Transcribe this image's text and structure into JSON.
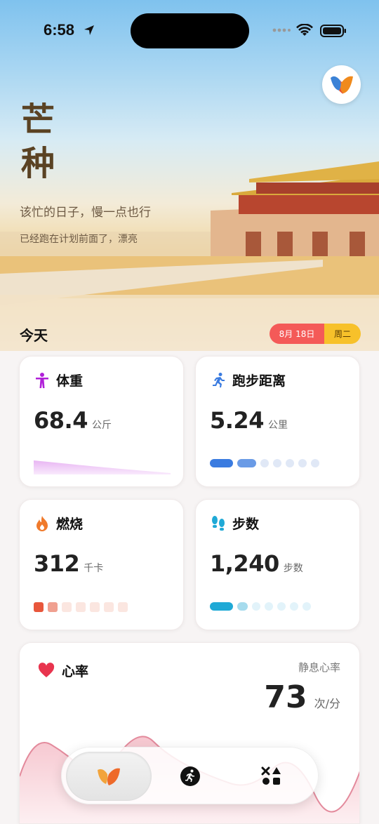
{
  "status": {
    "time": "6:58"
  },
  "hero": {
    "solar_term": "芒种",
    "slogan": "该忙的日子，慢一点也行",
    "subtitle": "已经跑在计划前面了，漂亮"
  },
  "today": {
    "label": "今天",
    "date": "8月 18日",
    "weekday": "周二"
  },
  "cards": {
    "weight": {
      "title": "体重",
      "value": "68.4",
      "unit": "公斤",
      "icon": "person-icon"
    },
    "distance": {
      "title": "跑步距离",
      "value": "5.24",
      "unit": "公里",
      "icon": "runner-icon",
      "progress_filled": 2,
      "progress_total": 7
    },
    "burn": {
      "title": "燃烧",
      "value": "312",
      "unit": "千卡",
      "icon": "flame-icon",
      "progress_filled": 2,
      "progress_total": 7
    },
    "steps": {
      "title": "步数",
      "value": "1,240",
      "unit": "步数",
      "icon": "footprints-icon",
      "progress_filled": 2,
      "progress_total": 7
    },
    "heart": {
      "title": "心率",
      "resting_label": "静息心率",
      "value": "73",
      "unit": "次/分",
      "icon": "heart-icon"
    }
  },
  "tabbar": {
    "items": [
      {
        "name": "home",
        "icon": "brand-logo-icon",
        "active": true
      },
      {
        "name": "running",
        "icon": "runner-circle-icon",
        "active": false
      },
      {
        "name": "more",
        "icon": "shapes-icon",
        "active": false
      }
    ]
  },
  "colors": {
    "date_red": "#f45a58",
    "weekday_yellow": "#f7c12a",
    "distance_blue": "#3a7be0",
    "burn_orange": "#e8573c",
    "steps_cyan": "#1fa9d6",
    "heart_red": "#e8344e"
  }
}
